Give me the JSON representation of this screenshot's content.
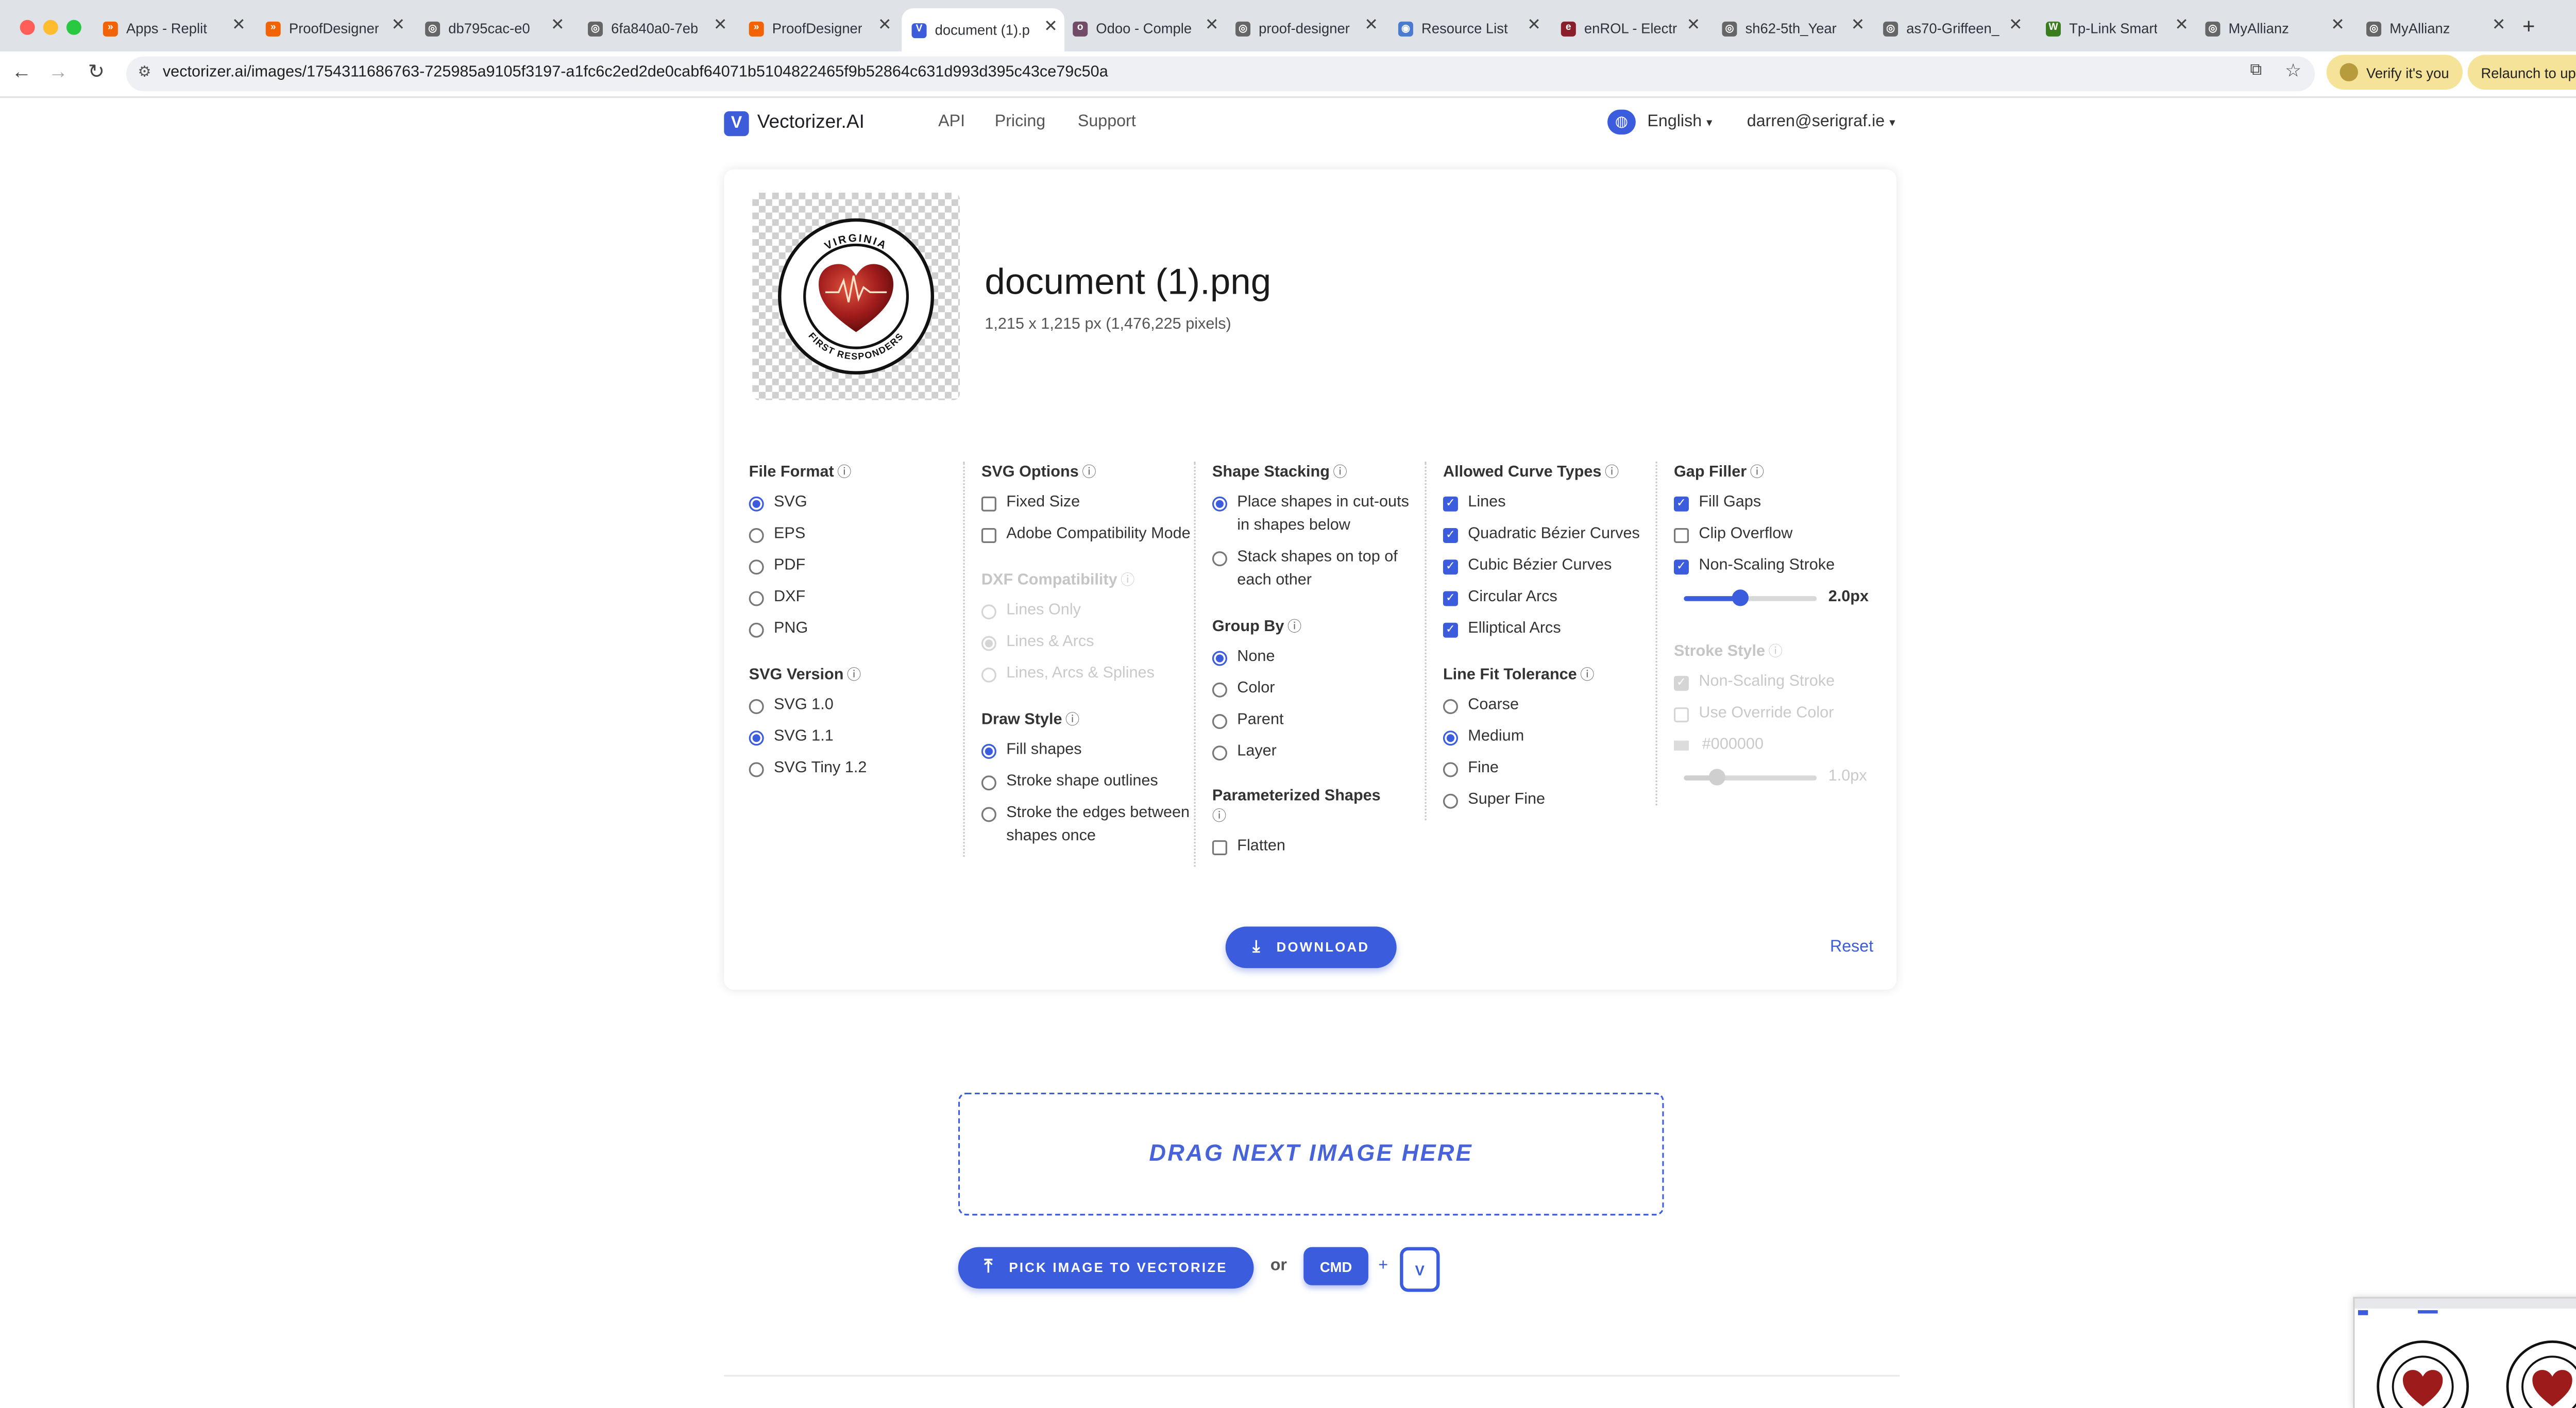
{
  "browser": {
    "tabs": [
      {
        "title": "Apps - Replit",
        "icon": "replit-icon",
        "color": "#f26207"
      },
      {
        "title": "ProofDesigner",
        "icon": "replit-icon",
        "color": "#f26207"
      },
      {
        "title": "db795cac-e0",
        "icon": "globe-icon",
        "color": "#555555"
      },
      {
        "title": "6fa840a0-7eb",
        "icon": "globe-icon",
        "color": "#555555"
      },
      {
        "title": "ProofDesigner",
        "icon": "replit-icon",
        "color": "#f26207"
      },
      {
        "title": "document (1).p",
        "icon": "vectorizer-icon",
        "color": "#3d5cd9"
      },
      {
        "title": "Odoo - Comple",
        "icon": "odoo-icon",
        "color": "#714b67"
      },
      {
        "title": "proof-designer",
        "icon": "globe-icon",
        "color": "#555555"
      },
      {
        "title": "Resource List",
        "icon": "resource-icon",
        "color": "#4a7bd0"
      },
      {
        "title": "enROL - Electr",
        "icon": "enrol-icon",
        "color": "#8b1e2b"
      },
      {
        "title": "sh62-5th_Year",
        "icon": "globe-icon",
        "color": "#555555"
      },
      {
        "title": "as70-Griffeen_",
        "icon": "globe-icon",
        "color": "#555555"
      },
      {
        "title": "Tp-Link Smart",
        "icon": "tplink-icon",
        "color": "#3a7d1f"
      },
      {
        "title": "MyAllianz",
        "icon": "globe-icon",
        "color": "#555555"
      },
      {
        "title": "MyAllianz",
        "icon": "globe-icon",
        "color": "#555555"
      }
    ],
    "url": "vectorizer.ai/images/1754311686763-725985a9105f3197-a1fc6c2ed2de0cabf64071b5104822465f9b52864c631d993d395c43ce79c50a",
    "verify_label": "Verify it's you",
    "relaunch_label": "Relaunch to update"
  },
  "site": {
    "brand": "Vectorizer.AI",
    "nav": [
      "API",
      "Pricing",
      "Support"
    ],
    "language": "English",
    "account": "darren@serigraf.ie"
  },
  "image": {
    "filename": "document (1).png",
    "dimensions": "1,215 x 1,215 px (1,476,225 pixels)",
    "logo_top_text": "VIRGINIA",
    "logo_bottom_text": "FIRST RESPONDERS"
  },
  "options": {
    "file_format": {
      "title": "File Format",
      "options": [
        "SVG",
        "EPS",
        "PDF",
        "DXF",
        "PNG"
      ],
      "selected": "SVG"
    },
    "svg_version": {
      "title": "SVG Version",
      "options": [
        "SVG 1.0",
        "SVG 1.1",
        "SVG Tiny 1.2"
      ],
      "selected": "SVG 1.1"
    },
    "svg_options": {
      "title": "SVG Options",
      "fixed_size": "Fixed Size",
      "adobe": "Adobe Compatibility Mode"
    },
    "dxf": {
      "title": "DXF Compatibility",
      "options": [
        "Lines Only",
        "Lines & Arcs",
        "Lines, Arcs & Splines"
      ],
      "selected": "Lines & Arcs"
    },
    "draw_style": {
      "title": "Draw Style",
      "options": [
        "Fill shapes",
        "Stroke shape outlines",
        "Stroke the edges between shapes once"
      ],
      "selected": "Fill shapes"
    },
    "shape_stacking": {
      "title": "Shape Stacking",
      "options": [
        "Place shapes in cut-outs in shapes below",
        "Stack shapes on top of each other"
      ],
      "selected": "Place shapes in cut-outs in shapes below"
    },
    "group_by": {
      "title": "Group By",
      "options": [
        "None",
        "Color",
        "Parent",
        "Layer"
      ],
      "selected": "None"
    },
    "parameterized": {
      "title": "Parameterized Shapes",
      "flatten": "Flatten"
    },
    "curve_types": {
      "title": "Allowed Curve Types",
      "options": [
        "Lines",
        "Quadratic Bézier Curves",
        "Cubic Bézier Curves",
        "Circular Arcs",
        "Elliptical Arcs"
      ]
    },
    "line_fit": {
      "title": "Line Fit Tolerance",
      "options": [
        "Coarse",
        "Medium",
        "Fine",
        "Super Fine"
      ],
      "selected": "Medium"
    },
    "gap_filler": {
      "title": "Gap Filler",
      "fill_gaps": "Fill Gaps",
      "clip_overflow": "Clip Overflow",
      "non_scaling": "Non-Scaling Stroke",
      "stroke_value": "2.0px",
      "stroke_fraction": 0.42
    },
    "stroke_style": {
      "title": "Stroke Style",
      "non_scaling": "Non-Scaling Stroke",
      "override": "Use Override Color",
      "color": "#000000",
      "value": "1.0px",
      "fraction": 0.25
    }
  },
  "actions": {
    "download": "DOWNLOAD",
    "reset": "Reset",
    "dropzone": "DRAG NEXT IMAGE HERE",
    "pick": "PICK IMAGE TO VECTORIZE",
    "or": "or",
    "cmd": "CMD",
    "plus": "+",
    "v": "V"
  },
  "colors": {
    "accent": "#3b5ddd",
    "tab_bar": "#dfe3e8",
    "verify_pill": "#f5e39a"
  }
}
